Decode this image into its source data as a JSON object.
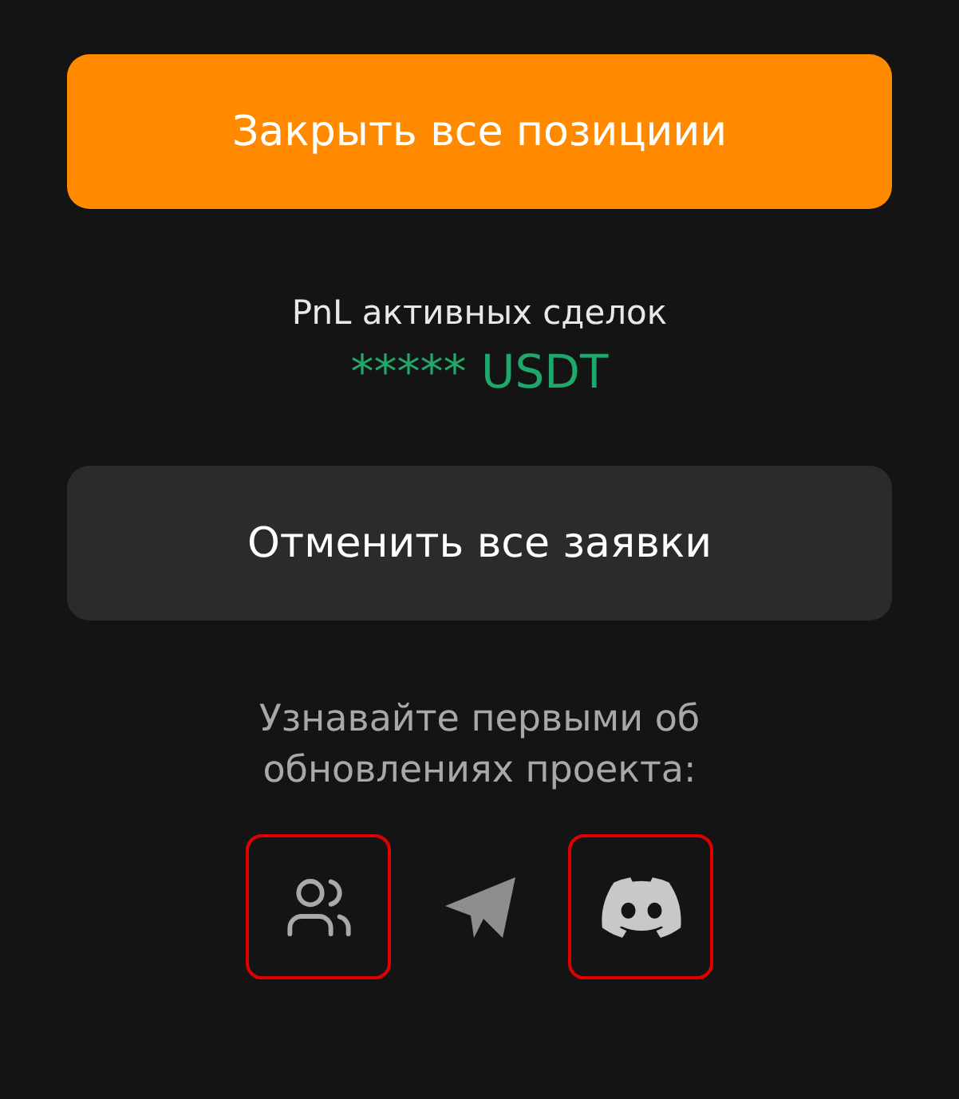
{
  "close_button": {
    "label": "Закрыть все позициии"
  },
  "pnl": {
    "label": "PnL активных сделок",
    "value": "***** USDT"
  },
  "cancel_button": {
    "label": "Отменить все заявки"
  },
  "subscribe": {
    "text": "Узнавайте первыми об обновлениях проекта:"
  },
  "socials": [
    {
      "kind": "community",
      "highlighted": true
    },
    {
      "kind": "telegram",
      "highlighted": false
    },
    {
      "kind": "discord",
      "highlighted": true
    }
  ]
}
